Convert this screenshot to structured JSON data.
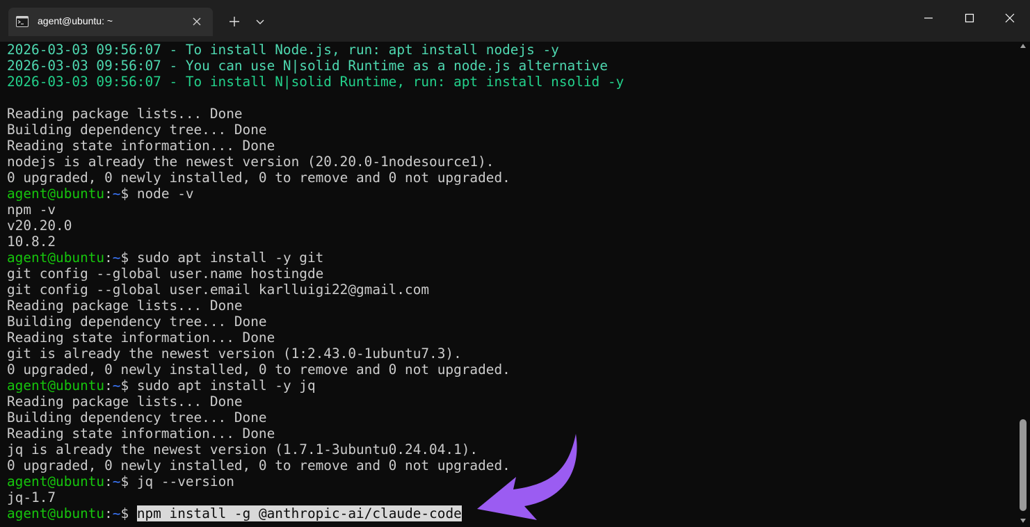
{
  "window": {
    "tab_title": "agent@ubuntu: ~",
    "icons": {
      "tab": "terminal-icon",
      "tab_close": "close-icon",
      "new_tab": "plus-icon",
      "dropdown": "chevron-down-icon",
      "minimize": "minimize-icon",
      "maximize": "maximize-icon",
      "close": "close-icon"
    }
  },
  "colors": {
    "background": "#0c0c0c",
    "titlebar": "#202020",
    "tab": "#2e2e2e",
    "text": "#cccccc",
    "log_green": "#23d18b",
    "log_teal": "#4ed8b0",
    "prompt_user": "#16c60c",
    "prompt_path": "#3b78ff",
    "selection": "#d9d9d9",
    "arrow": "#9b5cf2"
  },
  "prompt": {
    "user": "agent@ubuntu",
    "colon": ":",
    "path": "~",
    "dollar": "$ "
  },
  "terminal": {
    "logs": [
      "2026-03-03 09:56:07 - To install Node.js, run: apt install nodejs -y",
      "2026-03-03 09:56:07 - You can use N|solid Runtime as a node.js alternative",
      "2026-03-03 09:56:07 - To install N|solid Runtime, run: apt install nsolid -y"
    ],
    "node_install_output": [
      "Reading package lists... Done",
      "Building dependency tree... Done",
      "Reading state information... Done",
      "nodejs is already the newest version (20.20.0-1nodesource1).",
      "0 upgraded, 0 newly installed, 0 to remove and 0 not upgraded."
    ],
    "cmd_node": "node -v",
    "node_version_output": [
      "npm -v",
      "v20.20.0",
      "10.8.2"
    ],
    "cmd_git": "sudo apt install -y git",
    "git_output": [
      "git config --global user.name hostingde",
      "git config --global user.email karlluigi22@gmail.com",
      "Reading package lists... Done",
      "Building dependency tree... Done",
      "Reading state information... Done",
      "git is already the newest version (1:2.43.0-1ubuntu7.3).",
      "0 upgraded, 0 newly installed, 0 to remove and 0 not upgraded."
    ],
    "cmd_jq": "sudo apt install -y jq",
    "jq_output": [
      "Reading package lists... Done",
      "Building dependency tree... Done",
      "Reading state information... Done",
      "jq is already the newest version (1.7.1-3ubuntu0.24.04.1).",
      "0 upgraded, 0 newly installed, 0 to remove and 0 not upgraded."
    ],
    "cmd_jq_version": "jq --version",
    "jq_version_output": "jq-1.7",
    "cmd_current": "npm install -g @anthropic-ai/claude-code"
  },
  "annotation": {
    "icon": "curved-arrow-icon"
  }
}
